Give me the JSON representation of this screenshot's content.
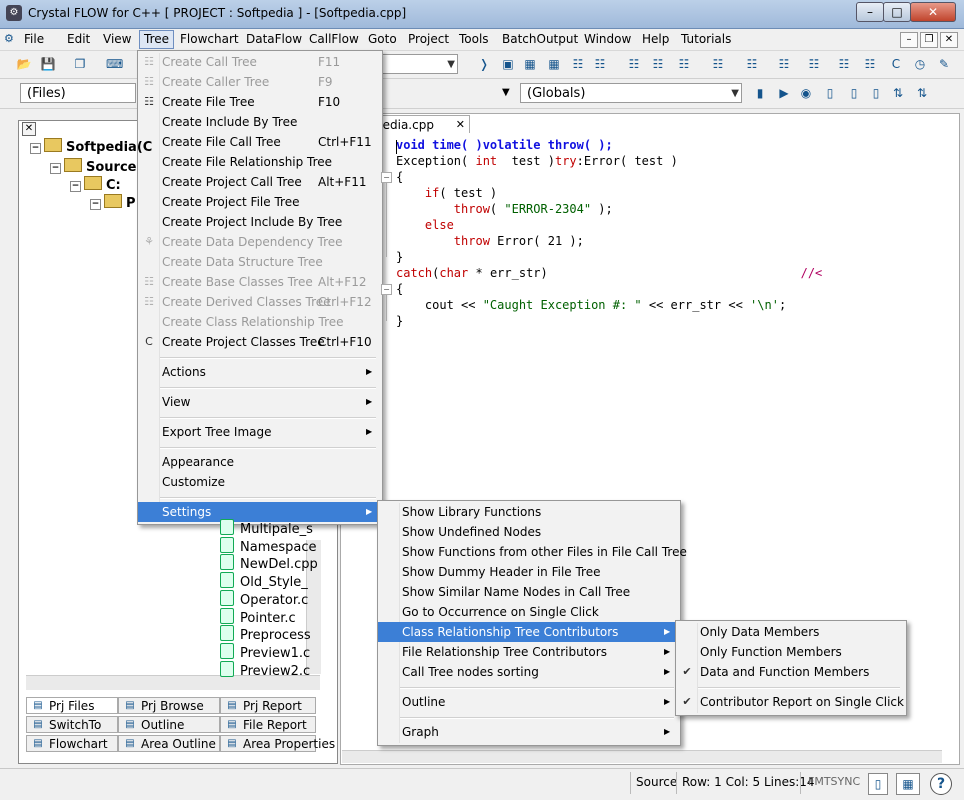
{
  "window": {
    "title": "Crystal FLOW for C++    [ PROJECT : Softpedia ] - [Softpedia.cpp]",
    "controls": {
      "minimize": "–",
      "maximize": "□",
      "close": "✕"
    }
  },
  "menubar": {
    "items": [
      "File",
      "Edit",
      "View",
      "Tree",
      "Flowchart",
      "DataFlow",
      "CallFlow",
      "Goto",
      "Project",
      "Tools",
      "BatchOutput",
      "Window",
      "Help",
      "Tutorials"
    ],
    "active": "Tree"
  },
  "toolbar": {
    "files_combo": "(Files)",
    "globals_combo": "(Globals)"
  },
  "left_pane": {
    "tree": [
      {
        "label": "Softpedia(C",
        "level": 0,
        "kind": "root"
      },
      {
        "label": "Source",
        "level": 1,
        "kind": "folder"
      },
      {
        "label": "C:",
        "level": 2,
        "kind": "folder"
      },
      {
        "label": "P",
        "level": 3,
        "kind": "folder"
      }
    ],
    "files": [
      "Multipale_s",
      "Namespace",
      "NewDel.cpp",
      "Old_Style_",
      "Operator.c",
      "Pointer.c",
      "Preprocess",
      "Preview1.c",
      "Preview2.c"
    ],
    "tabs_row1": [
      "Prj Files",
      "Prj Browse",
      "Prj Report"
    ],
    "tabs_row2": [
      "SwitchTo",
      "Outline",
      "File Report"
    ],
    "tabs_row3": [
      "Flowchart",
      "Area Outline",
      "Area Properties"
    ]
  },
  "editor": {
    "tab_label": "pedia.cpp",
    "tab_close": "✕",
    "lines": [
      [
        {
          "t": "void time( )volatile throw( );",
          "c": "kw"
        }
      ],
      [
        {
          "t": "Exception( ",
          "c": ""
        },
        {
          "t": "int",
          "c": "rd"
        },
        {
          "t": "  test )",
          "c": ""
        },
        {
          "t": "try",
          "c": "rd"
        },
        {
          "t": ":Error( test )",
          "c": ""
        }
      ],
      [
        {
          "t": "{",
          "c": ""
        }
      ],
      [
        {
          "t": "    ",
          "c": ""
        },
        {
          "t": "if",
          "c": "rd"
        },
        {
          "t": "( test )",
          "c": ""
        }
      ],
      [
        {
          "t": "        ",
          "c": ""
        },
        {
          "t": "throw",
          "c": "rd"
        },
        {
          "t": "( ",
          "c": ""
        },
        {
          "t": "\"ERROR-2304\"",
          "c": "str"
        },
        {
          "t": " );",
          "c": ""
        }
      ],
      [
        {
          "t": "    ",
          "c": ""
        },
        {
          "t": "else",
          "c": "rd"
        }
      ],
      [
        {
          "t": "        ",
          "c": ""
        },
        {
          "t": "throw",
          "c": "rd"
        },
        {
          "t": " Error( 21 );",
          "c": ""
        }
      ],
      [
        {
          "t": "}",
          "c": ""
        }
      ],
      [
        {
          "t": "catch",
          "c": "rd"
        },
        {
          "t": "(",
          "c": ""
        },
        {
          "t": "char",
          "c": "rd"
        },
        {
          "t": " * err_str)",
          "c": ""
        },
        {
          "t": "                                   //<",
          "c": "ty"
        }
      ],
      [
        {
          "t": "{",
          "c": ""
        }
      ],
      [
        {
          "t": "    cout << ",
          "c": ""
        },
        {
          "t": "\"Caught Exception #: \"",
          "c": "str"
        },
        {
          "t": " << err_str << ",
          "c": ""
        },
        {
          "t": "'\\n'",
          "c": "str"
        },
        {
          "t": ";",
          "c": ""
        }
      ],
      [
        {
          "t": "}",
          "c": ""
        }
      ]
    ]
  },
  "tree_menu": {
    "items": [
      {
        "label": "Create Call Tree",
        "shortcut": "F11",
        "disabled": true,
        "icon": "call-tree-icon",
        "glyph": "☷"
      },
      {
        "label": "Create Caller Tree",
        "shortcut": "F9",
        "disabled": true,
        "icon": "caller-tree-icon",
        "glyph": "☷"
      },
      {
        "label": "Create File Tree",
        "shortcut": "F10",
        "disabled": false,
        "icon": "file-tree-icon",
        "glyph": "☷"
      },
      {
        "label": "Create Include By Tree",
        "shortcut": "",
        "disabled": false
      },
      {
        "label": "Create File Call Tree",
        "shortcut": "Ctrl+F11",
        "disabled": false
      },
      {
        "label": "Create File Relationship Tree",
        "shortcut": "",
        "disabled": false
      },
      {
        "label": "Create Project Call Tree",
        "shortcut": "Alt+F11",
        "disabled": false
      },
      {
        "label": "Create Project File Tree",
        "shortcut": "",
        "disabled": false
      },
      {
        "label": "Create Project Include By Tree",
        "shortcut": "",
        "disabled": false
      },
      {
        "label": "Create Data Dependency Tree",
        "shortcut": "",
        "disabled": true,
        "icon": "data-dependency-icon",
        "glyph": "⚘"
      },
      {
        "label": "Create Data Structure Tree",
        "shortcut": "",
        "disabled": true
      },
      {
        "label": "Create Base Classes Tree",
        "shortcut": "Alt+F12",
        "disabled": true,
        "icon": "base-classes-icon",
        "glyph": "☷"
      },
      {
        "label": "Create Derived Classes Tree",
        "shortcut": "Ctrl+F12",
        "disabled": true,
        "icon": "derived-classes-icon",
        "glyph": "☷"
      },
      {
        "label": "Create Class Relationship Tree",
        "shortcut": "",
        "disabled": true
      },
      {
        "label": "Create Project Classes Tree",
        "shortcut": "Ctrl+F10",
        "disabled": false,
        "icon": "project-classes-icon",
        "glyph": "C"
      }
    ],
    "group_actions": [
      "Actions"
    ],
    "group_view": [
      "View"
    ],
    "group_export": [
      "Export Tree Image"
    ],
    "group_appearance": [
      "Appearance",
      "Customize"
    ],
    "settings": "Settings"
  },
  "settings_menu": {
    "items": [
      "Show Library Functions",
      "Show Undefined Nodes",
      "Show Functions from other Files in File Call Tree",
      "Show Dummy Header in File Tree",
      "Show Similar Name Nodes in Call Tree",
      "Go to Occurrence on Single Click",
      "Class Relationship Tree Contributors",
      "File Relationship Tree Contributors",
      "Call Tree nodes sorting"
    ],
    "submenus": [
      "Class Relationship Tree Contributors",
      "File Relationship Tree Contributors",
      "Call Tree nodes sorting"
    ],
    "highlighted": "Class Relationship Tree Contributors",
    "outline": "Outline",
    "graph": "Graph"
  },
  "contributors_menu": {
    "items": [
      {
        "label": "Only Data Members",
        "checked": false
      },
      {
        "label": "Only Function Members",
        "checked": false
      },
      {
        "label": "Data and Function Members",
        "checked": true
      }
    ],
    "report": {
      "label": "Contributor Report on Single Click",
      "checked": true
    },
    "check_glyph": "✔"
  },
  "statusbar": {
    "mode": "Source",
    "position": "Row: 1 Col:  5 Lines:14",
    "sync": "FMTSYNC",
    "help": "?"
  }
}
